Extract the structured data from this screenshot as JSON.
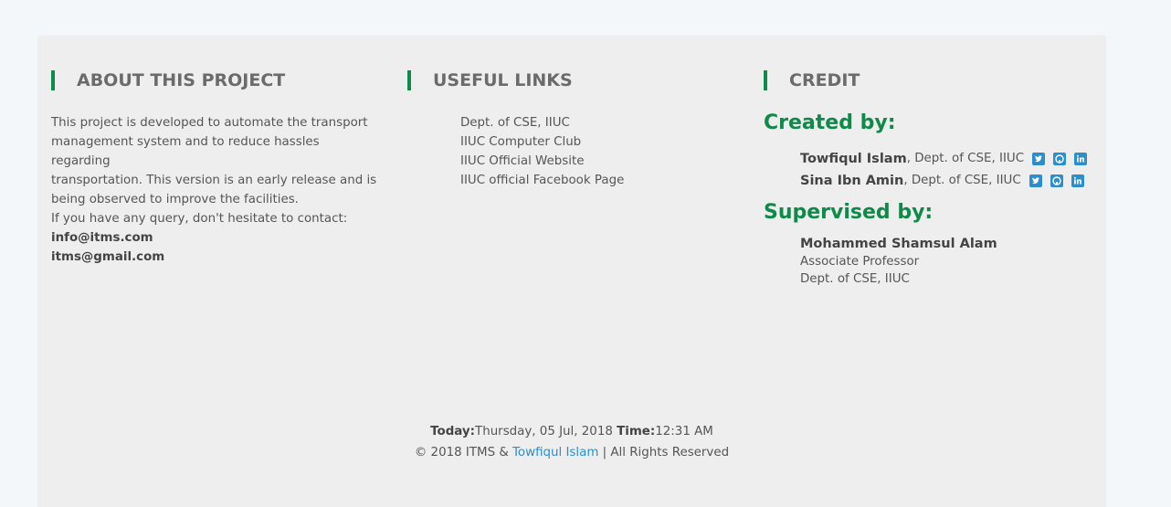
{
  "about": {
    "heading": "ABOUT THIS PROJECT",
    "description_lines": [
      "This project is developed to automate the transport",
      "management system and to reduce hassles regarding",
      "transportation. This version is an early release and is",
      "being observed to improve the facilities."
    ],
    "contact_prompt": "If you have any query, don't hesitate to contact:",
    "emails": [
      "info@itms.com",
      "itms@gmail.com"
    ]
  },
  "links": {
    "heading": "USEFUL LINKS",
    "items": [
      "Dept. of CSE, IIUC",
      "IIUC Computer Club",
      "IIUC Official Website",
      "IIUC official Facebook Page"
    ]
  },
  "credit": {
    "heading": "CREDIT",
    "created_by_label": "Created by:",
    "creators": [
      {
        "name": "Towfiqul Islam",
        "affiliation": ", Dept. of CSE, IIUC",
        "icons": [
          "twitter-icon",
          "github-icon",
          "linkedin-icon"
        ]
      },
      {
        "name": "Sina Ibn Amin",
        "affiliation": ", Dept. of CSE, IIUC",
        "icons": [
          "twitter-icon",
          "github-icon",
          "linkedin-icon"
        ]
      }
    ],
    "supervised_by_label": "Supervised by:",
    "supervisor": {
      "name": "Mohammed Shamsul Alam",
      "title": "Associate Professor",
      "dept": "Dept. of CSE, IIUC"
    }
  },
  "bottom": {
    "today_label": "Today:",
    "today_value": "Thursday, 05 Jul, 2018",
    "time_label": "Time:",
    "time_value": "12:31 AM",
    "copyright_prefix": "© 2018 ITMS & ",
    "author_link": "Towfiqul Islam",
    "copyright_suffix": " | All Rights Reserved"
  },
  "colors": {
    "accent_green": "#0f8a4b",
    "link_blue": "#2c8fcb",
    "footer_bg": "#eeeeee",
    "page_bg": "#f3f7fa"
  }
}
